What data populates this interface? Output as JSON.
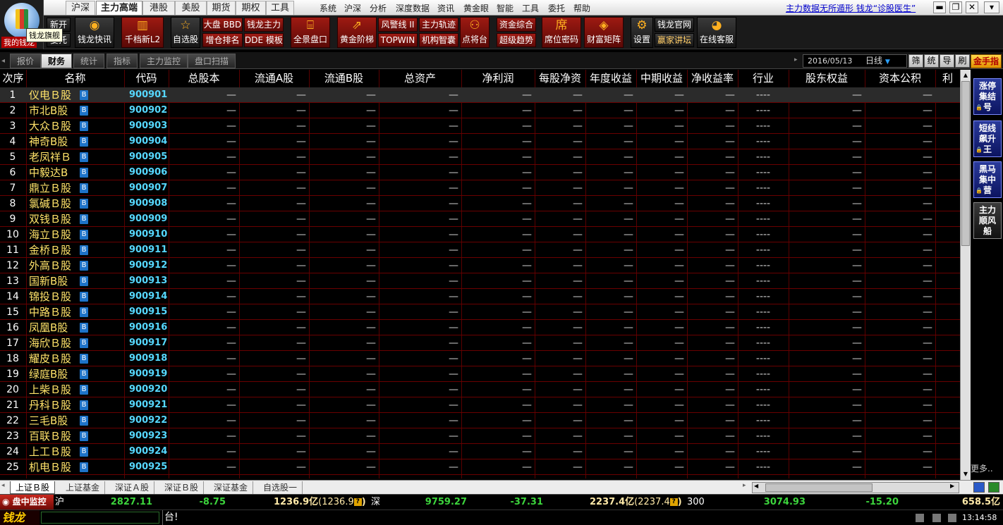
{
  "topmenu": {
    "tabs": [
      "沪深",
      "主力高端",
      "港股",
      "美股",
      "期货",
      "期权",
      "工具"
    ],
    "items": [
      "系统",
      "沪深",
      "分析",
      "深度数据",
      "资讯",
      "黄金眼",
      "智能",
      "工具",
      "委托",
      "帮助"
    ],
    "marquee": "主力数据无所遁形 钱龙“诊股医生”"
  },
  "logo": {
    "label": "我的钱龙",
    "tooltip": "钱龙旗舰"
  },
  "toolbar": {
    "b_xinkai": "新开",
    "b_weituo": "委托",
    "b_kuaixun": "钱龙快讯",
    "b_qiandang": "千档新L2",
    "b_zixuan": "自选股",
    "b_dapan": "大盘 BBD",
    "b_zengcang": "增仓排名",
    "b_zhuli": "钱龙主力",
    "b_dde": "DDE 模板",
    "b_quanjing": "全景盘口",
    "b_huangjin": "黄金阶梯",
    "b_fengjing": "风警线 II",
    "b_topwin": "TOPWIN",
    "b_zhuli_gj": "主力轨迹",
    "b_jigou": "机构智囊",
    "b_dianjiang": "点将台",
    "b_zijin": "资金综合",
    "b_chaoji": "超级趋势",
    "b_xiwei": "席位密码",
    "b_caifu": "财富矩阵",
    "b_shezhi": "设置",
    "b_guanwang": "钱龙官网",
    "b_yingjia": "赢家讲坛",
    "b_kefu": "在线客服"
  },
  "subtabs": [
    "报价",
    "财务",
    "统计",
    "指标",
    "主力监控",
    "盘口扫描"
  ],
  "date": "2016/05/13",
  "period": "日线",
  "side_small": [
    "筛",
    "统",
    "导",
    "刷"
  ],
  "gold_btn": "金手指",
  "columns": [
    "次序",
    "名称",
    "代码",
    "总股本",
    "流通A股",
    "流通B股",
    "总资产",
    "净利润",
    "每股净资",
    "年度收益",
    "中期收益",
    "净收益率",
    "行业",
    "股东权益",
    "资本公积",
    "利"
  ],
  "dash": "—",
  "ind_dash": "----",
  "badge": "B",
  "rows": [
    {
      "no": "1",
      "name": "仪电Ｂ股",
      "code": "900901"
    },
    {
      "no": "2",
      "name": "市北B股",
      "code": "900902"
    },
    {
      "no": "3",
      "name": "大众Ｂ股",
      "code": "900903"
    },
    {
      "no": "4",
      "name": "神奇B股",
      "code": "900904"
    },
    {
      "no": "5",
      "name": "老凤祥Ｂ",
      "code": "900905"
    },
    {
      "no": "6",
      "name": "中毅达B",
      "code": "900906"
    },
    {
      "no": "7",
      "name": "鼎立Ｂ股",
      "code": "900907"
    },
    {
      "no": "8",
      "name": "氯碱Ｂ股",
      "code": "900908"
    },
    {
      "no": "9",
      "name": "双钱Ｂ股",
      "code": "900909"
    },
    {
      "no": "10",
      "name": "海立Ｂ股",
      "code": "900910"
    },
    {
      "no": "11",
      "name": "金桥Ｂ股",
      "code": "900911"
    },
    {
      "no": "12",
      "name": "外高Ｂ股",
      "code": "900912"
    },
    {
      "no": "13",
      "name": "国新B股",
      "code": "900913"
    },
    {
      "no": "14",
      "name": "锦投Ｂ股",
      "code": "900914"
    },
    {
      "no": "15",
      "name": "中路Ｂ股",
      "code": "900915"
    },
    {
      "no": "16",
      "name": "凤凰B股",
      "code": "900916"
    },
    {
      "no": "17",
      "name": "海欣Ｂ股",
      "code": "900917"
    },
    {
      "no": "18",
      "name": "耀皮Ｂ股",
      "code": "900918"
    },
    {
      "no": "19",
      "name": "绿庭B股",
      "code": "900919"
    },
    {
      "no": "20",
      "name": "上柴Ｂ股",
      "code": "900920"
    },
    {
      "no": "21",
      "name": "丹科Ｂ股",
      "code": "900921"
    },
    {
      "no": "22",
      "name": "三毛B股",
      "code": "900922"
    },
    {
      "no": "23",
      "name": "百联Ｂ股",
      "code": "900923"
    },
    {
      "no": "24",
      "name": "上工Ｂ股",
      "code": "900924"
    },
    {
      "no": "25",
      "name": "机电Ｂ股",
      "code": "900925"
    }
  ],
  "right_panel": [
    "涨停集结号",
    "短线飙升王",
    "黑马集中营",
    "主力顺风船"
  ],
  "more": "更多..",
  "bottom_tabs": [
    "上证Ｂ股",
    "上证基金",
    "深证Ａ股",
    "深证Ｂ股",
    "深证基金",
    "自选股一"
  ],
  "status": {
    "monitor": "盘中监控",
    "sh_label": "沪",
    "sh_index": "2827.11",
    "sh_change": "-8.75",
    "sh_amount": "1236.9亿",
    "sh_amount2": "(1236.9",
    "sz_label": "深",
    "sz_index": "9759.27",
    "sz_change": "-37.31",
    "sz_amount": "2237.4亿",
    "sz_amount2": "(2237.4",
    "c3_label": "300",
    "c3_index": "3074.93",
    "c3_change": "-15.20",
    "c3_amount": "658.5亿"
  },
  "ticker": {
    "brand": "钱龙",
    "message": "台!",
    "time": "13:14:58"
  }
}
